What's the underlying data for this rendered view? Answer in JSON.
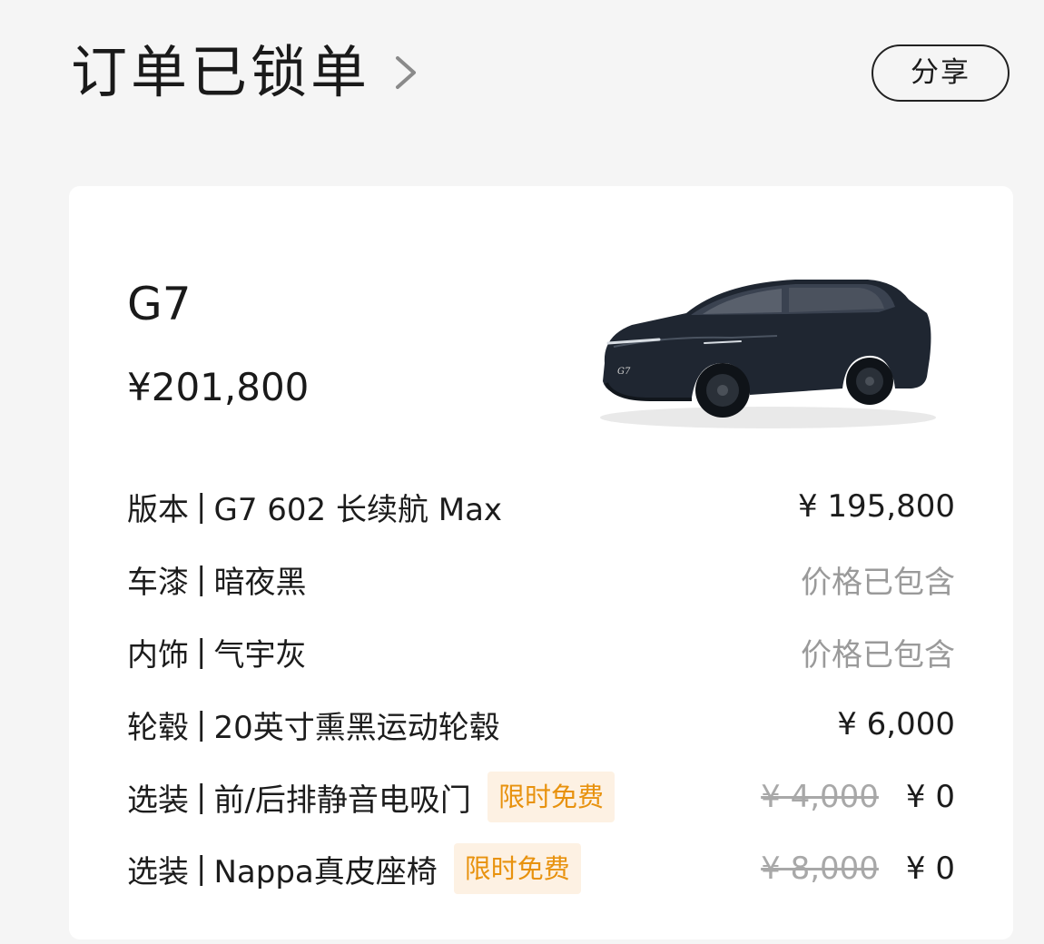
{
  "header": {
    "title": "订单已锁单",
    "share_label": "分享"
  },
  "card": {
    "model": "G7",
    "price": "¥201,800",
    "car_image_alt": "G7",
    "rows": [
      {
        "category": "版本",
        "value": "G7 602 长续航 Max",
        "badge": "",
        "original_price": "",
        "price": "¥ 195,800",
        "price_muted": false
      },
      {
        "category": "车漆",
        "value": "暗夜黑",
        "badge": "",
        "original_price": "",
        "price": "价格已包含",
        "price_muted": true
      },
      {
        "category": "内饰",
        "value": "气宇灰",
        "badge": "",
        "original_price": "",
        "price": "价格已包含",
        "price_muted": true
      },
      {
        "category": "轮毂",
        "value": "20英寸熏黑运动轮毂",
        "badge": "",
        "original_price": "",
        "price": "¥ 6,000",
        "price_muted": false
      },
      {
        "category": "选装",
        "value": "前/后排静音电吸门",
        "badge": "限时免费",
        "original_price": "¥ 4,000",
        "price": "¥ 0",
        "price_muted": false
      },
      {
        "category": "选装",
        "value": "Nappa真皮座椅",
        "badge": "限时免费",
        "original_price": "¥ 8,000",
        "price": "¥ 0",
        "price_muted": false
      }
    ],
    "separator": "|"
  },
  "colors": {
    "background": "#f5f5f5",
    "card": "#ffffff",
    "badge_bg": "#fdf1e3",
    "badge_text": "#e8920e",
    "muted_text": "#9a9a9a",
    "car_body": "#1f2631"
  },
  "icons": {
    "chevron": "chevron-right-icon"
  }
}
